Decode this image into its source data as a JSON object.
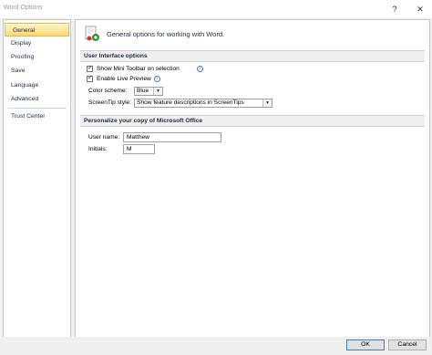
{
  "window": {
    "title": "Word Options",
    "help_glyph": "?",
    "close_glyph": "✕"
  },
  "sidebar": {
    "items": [
      {
        "label": "General"
      },
      {
        "label": "Display"
      },
      {
        "label": "Proofing"
      },
      {
        "label": "Save"
      },
      {
        "label": "Language"
      },
      {
        "label": "Advanced"
      },
      {
        "label": "Trust Center"
      }
    ],
    "selected": "General"
  },
  "main": {
    "header": "General options for working with Word.",
    "ui_options": {
      "title": "User Interface options",
      "show_mini_toolbar": {
        "label": "Show Mini Toolbar on selection",
        "checked": true
      },
      "enable_live_preview": {
        "label": "Enable Live Preview",
        "checked": true
      },
      "color_scheme": {
        "label": "Color scheme:",
        "value": "Blue"
      },
      "screentip_style": {
        "label": "ScreenTip style:",
        "value": "Show feature descriptions in ScreenTips"
      }
    },
    "personalize": {
      "title": "Personalize your copy of Microsoft Office",
      "user_name": {
        "label": "User name:",
        "value": "Matthew"
      },
      "initials": {
        "label": "Initials:",
        "value": "M"
      }
    }
  },
  "footer": {
    "ok": "OK",
    "cancel": "Cancel"
  }
}
